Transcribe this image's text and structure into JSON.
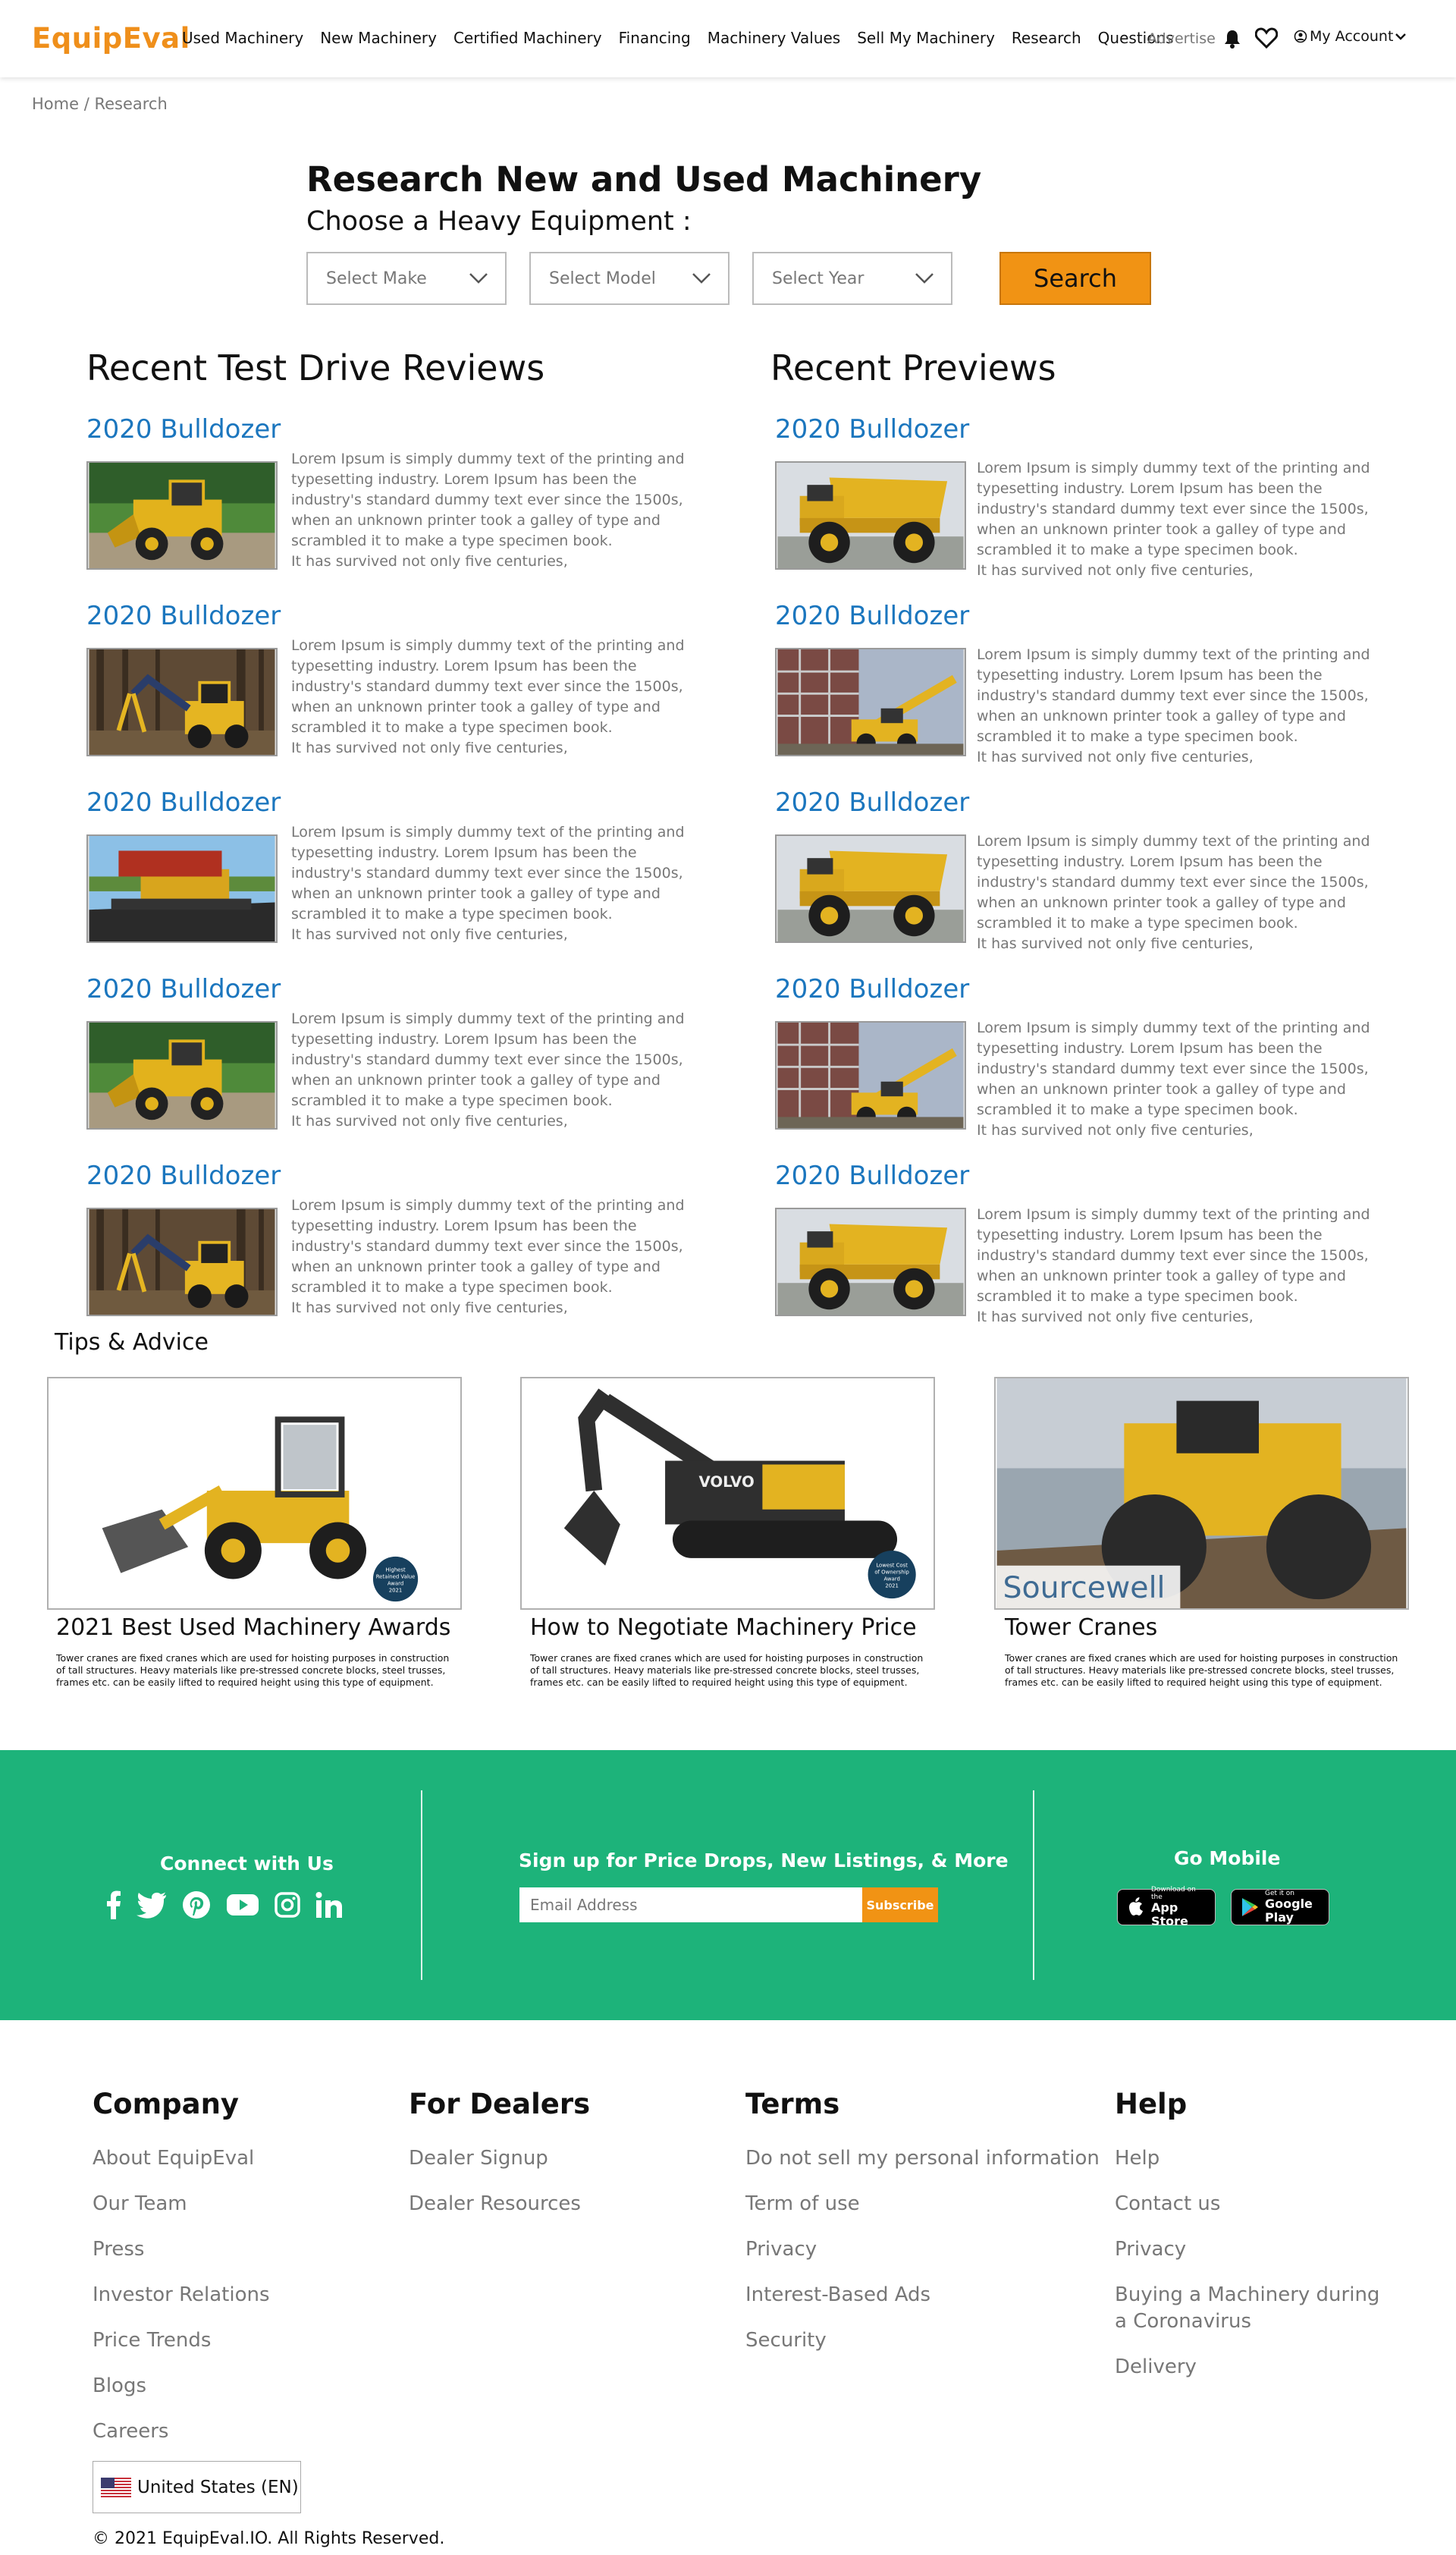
{
  "header": {
    "logo": "EquipEval",
    "nav": [
      "Used Machinery",
      "New Machinery",
      "Certified Machinery",
      "Financing",
      "Machinery Values",
      "Sell My Machinery",
      "Research",
      "Questions"
    ],
    "advertise": "Advertise",
    "account": "My Account",
    "bell_icon": "bell-icon",
    "heart_icon": "heart-icon"
  },
  "breadcrumb": {
    "home": "Home",
    "sep": " / ",
    "current": "Research"
  },
  "search": {
    "title": "Research New and Used Machinery",
    "subtitle": "Choose a Heavy Equipment :",
    "make": "Select Make",
    "model": "Select Model",
    "year": "Select Year",
    "button": "Search"
  },
  "reviews": {
    "left_title": "Recent Test Drive Reviews",
    "right_title": "Recent Previews",
    "item_title": "2020 Bulldozer",
    "desc_lines": [
      "Lorem Ipsum is simply dummy text of the printing and",
      " typesetting industry. Lorem Ipsum has been the",
      " industry's standard dummy text ever since the 1500s,",
      "when an unknown printer took a galley of type and",
      "scrambled it to make a type specimen book.",
      "It has survived not only five centuries,"
    ],
    "left_images": [
      "wheel-loader",
      "forestry-machine",
      "asphalt-paver",
      "wheel-loader",
      "forestry-machine"
    ],
    "right_images": [
      "dump-truck",
      "telehandler",
      "dump-truck",
      "telehandler",
      "dump-truck"
    ]
  },
  "tips": {
    "title": "Tips & Advice",
    "cards": [
      {
        "title": "2021 Best Used Machinery Awards",
        "badge": [
          "Highest",
          "Retained Value",
          "Award",
          "2021"
        ],
        "image": "compact-wheel-loader"
      },
      {
        "title": "How to Negotiate Machinery Price",
        "badge": [
          "Lowest Cost",
          "of Ownership",
          "Award",
          "2021"
        ],
        "brand": "VOLVO",
        "image": "volvo-excavator"
      },
      {
        "title": "Tower Cranes",
        "brand": "Sourcewell",
        "image": "compactor"
      }
    ],
    "desc_lines": [
      "Tower cranes are fixed cranes which are used for hoisting purposes in construction",
      " of tall structures. Heavy materials like pre-stressed concrete blocks, steel trusses,",
      "frames etc. can be easily lifted to required height using this type of equipment."
    ]
  },
  "connect": {
    "title": "Connect with Us",
    "icons": [
      "facebook-icon",
      "twitter-icon",
      "pinterest-icon",
      "youtube-icon",
      "instagram-icon",
      "linkedin-icon"
    ]
  },
  "newsletter": {
    "title": "Sign up for Price Drops, New Listings, & More",
    "placeholder": "Email Address",
    "button": "Subscribe"
  },
  "mobile": {
    "title": "Go Mobile",
    "appstore_small": "Download on the",
    "appstore_big": "App Store",
    "googleplay_small": "Get it on",
    "googleplay_big": "Google Play"
  },
  "footer": {
    "columns": [
      {
        "title": "Company",
        "links": [
          "About EquipEval",
          "Our Team",
          "Press",
          "Investor Relations",
          "Price Trends",
          "Blogs",
          "Careers"
        ]
      },
      {
        "title": "For Dealers",
        "links": [
          "Dealer Signup",
          "Dealer Resources"
        ]
      },
      {
        "title": "Terms",
        "links": [
          "Do not sell my personal information",
          "Term of use",
          "Privacy",
          "Interest-Based Ads",
          "Security"
        ]
      },
      {
        "title": "Help",
        "links": [
          "Help",
          "Contact us",
          "Privacy",
          "Buying a Machinery during",
          "a Coronavirus",
          "Delivery"
        ]
      }
    ],
    "language": "United States (EN)",
    "copyright": "© 2021 EquipEval.IO. All Rights Reserved."
  },
  "colors": {
    "brand_orange": "#ef8f1b",
    "link_blue": "#1b76be",
    "band_green": "#1db37a"
  }
}
